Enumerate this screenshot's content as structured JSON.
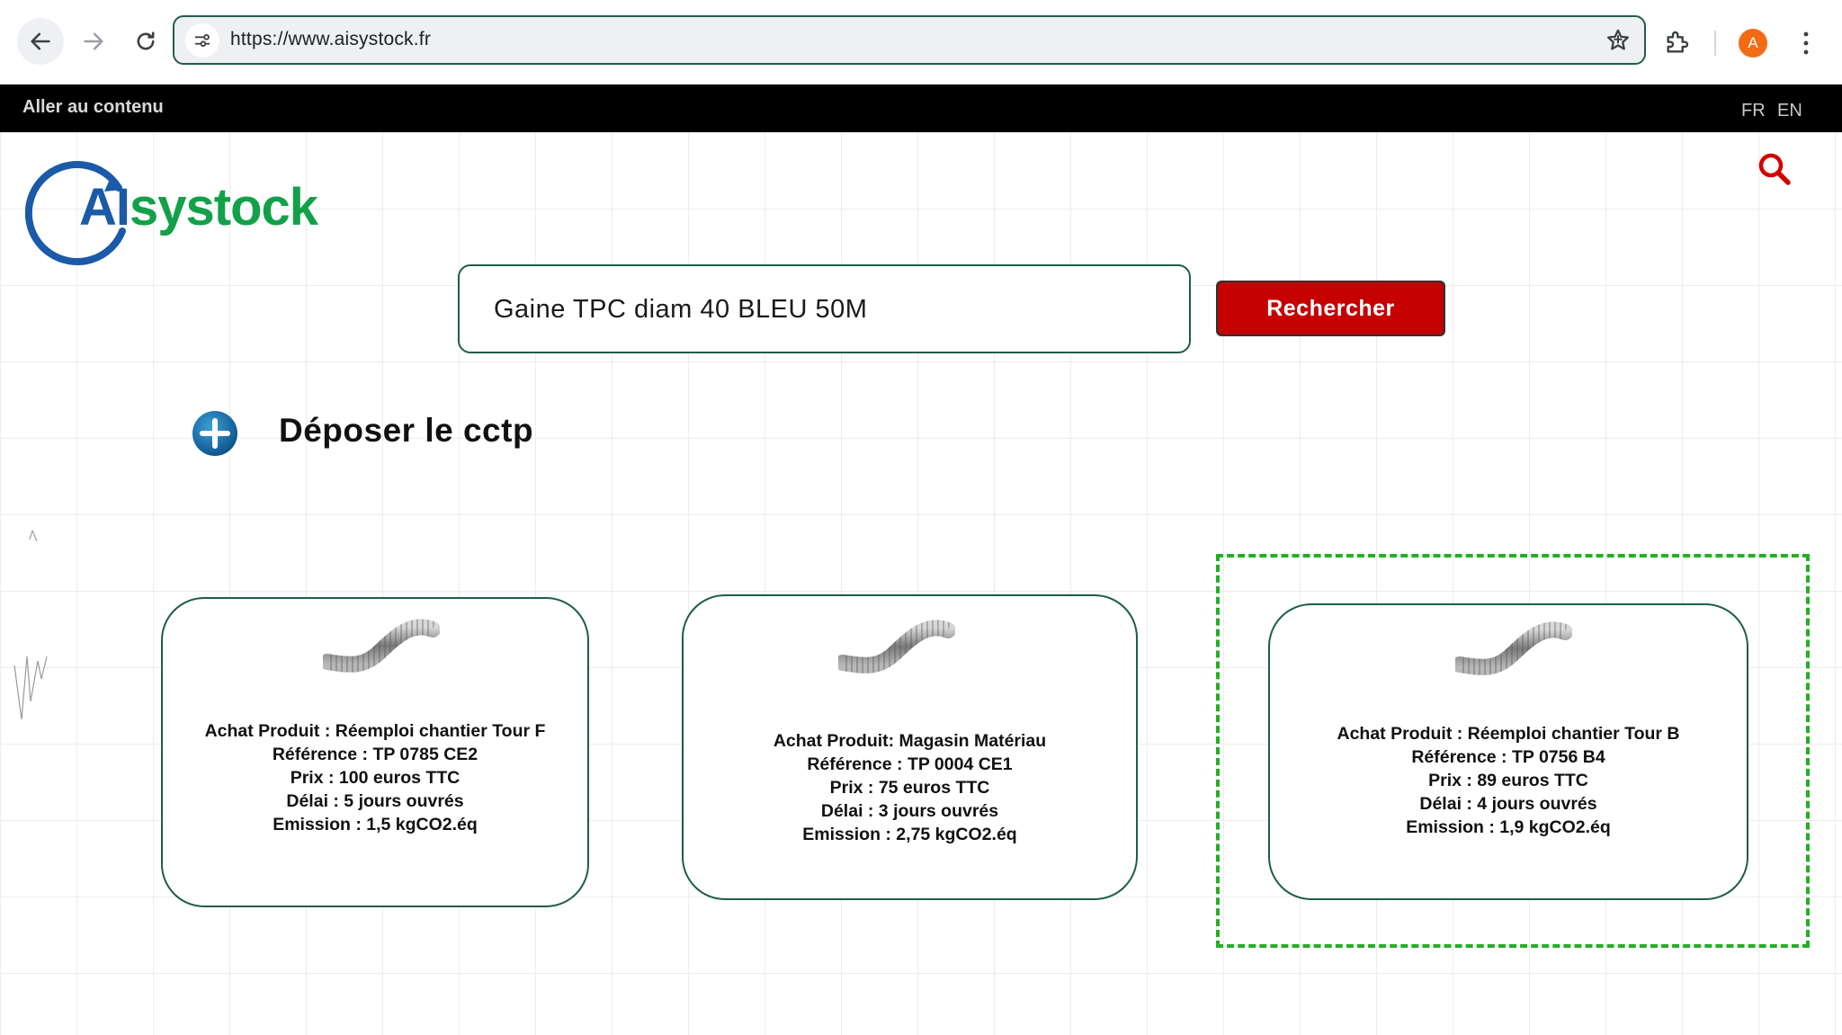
{
  "browser": {
    "url": "https://www.aisystock.fr",
    "profile_initial": "A",
    "icons": [
      "back-arrow-icon",
      "forward-arrow-icon",
      "reload-icon",
      "site-info-icon",
      "bookmark-star-icon",
      "extensions-icon",
      "more-menu-icon"
    ]
  },
  "topbar": {
    "skip_link": "Aller au contenu",
    "lang_fr": "FR",
    "lang_en": "EN"
  },
  "logo": {
    "prefix": "AI",
    "suffix": "systock"
  },
  "search": {
    "value": "Gaine TPC diam 40 BLEU 50M",
    "button_label": "Rechercher"
  },
  "upload": {
    "label": "Déposer le cctp"
  },
  "colors": {
    "accent_red": "#c40000",
    "brand_green": "#13a04a",
    "brand_blue": "#1a5aa8",
    "card_border": "#1e5e46",
    "highlight": "#22b022"
  },
  "products": [
    {
      "line1": "Achat Produit : Réemploi chantier Tour F",
      "line2": "Référence : TP 0785 CE2",
      "line3": "Prix : 100 euros TTC",
      "line4": "Délai : 5 jours ouvrés",
      "line5": "Emission : 1,5 kgCO2.éq"
    },
    {
      "line1": "Achat Produit: Magasin Matériau",
      "line2": "Référence : TP 0004 CE1",
      "line3": "Prix : 75 euros TTC",
      "line4": "Délai : 3 jours ouvrés",
      "line5": "Emission : 2,75 kgCO2.éq"
    },
    {
      "line1": "Achat Produit : Réemploi chantier Tour B",
      "line2": "Référence : TP 0756 B4",
      "line3": "Prix : 89  euros TTC",
      "line4": "Délai : 4 jours ouvrés",
      "line5": "Emission : 1,9 kgCO2.éq"
    }
  ]
}
